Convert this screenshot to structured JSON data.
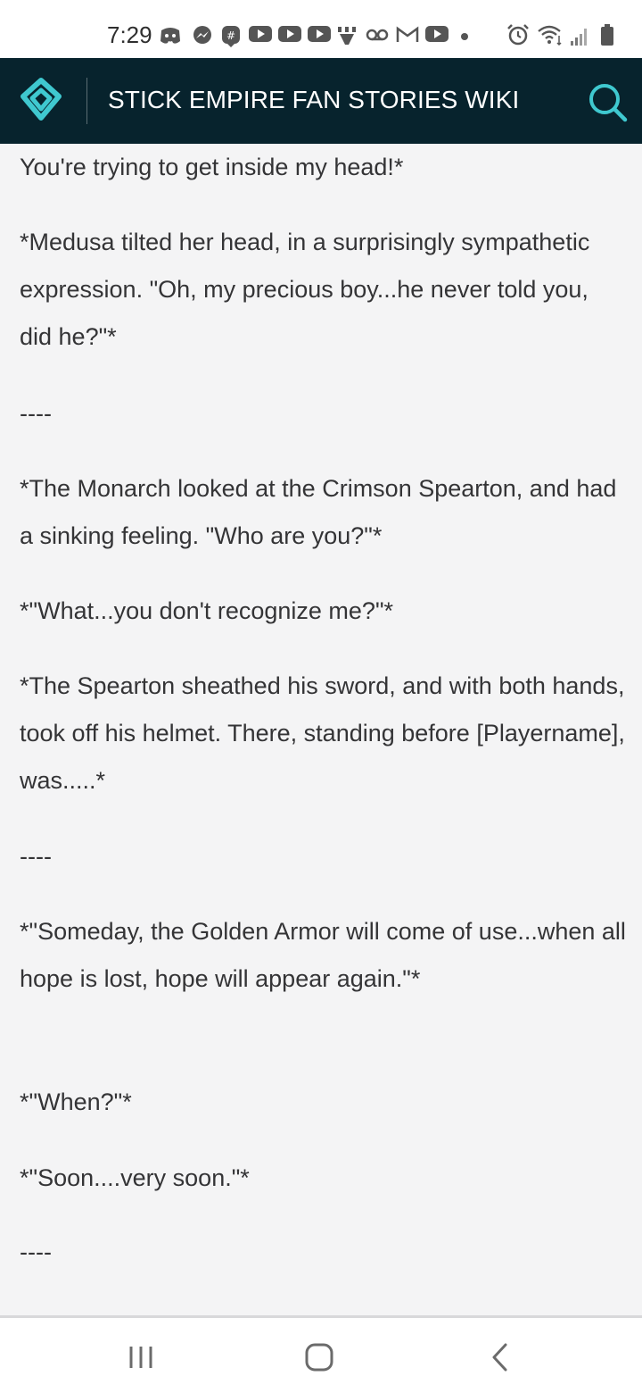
{
  "status_bar": {
    "time": "7:29",
    "left_icons": [
      "discord-icon",
      "messenger-icon",
      "groupme-icon",
      "youtube-icon",
      "youtube-icon",
      "youtube-icon",
      "app-icon",
      "voicemail-icon",
      "gmail-icon",
      "youtube-icon",
      "dot-icon"
    ],
    "right_icons": [
      "alarm-icon",
      "wifi-icon",
      "signal-icon",
      "battery-icon"
    ]
  },
  "header": {
    "title": "STICK EMPIRE FAN STORIES WIKI",
    "background": "#07232d",
    "accent": "#3fc8cf"
  },
  "article": {
    "paragraphs": [
      "You're trying to get inside my head!*",
      "*Medusa tilted her head, in a surprisingly sympathetic expression. \"Oh, my precious boy...he never told you, did he?\"*",
      "----",
      "*The Monarch looked at the Crimson Spearton, and had a sinking feeling. \"Who are you?\"*",
      "*\"What...you don't recognize me?\"*",
      "*The Spearton sheathed his sword, and with both hands, took off his helmet. There, standing before [Playername], was.....*",
      "----",
      "*\"Someday, the Golden Armor will come of use...when all hope is lost, hope will appear again.\"*",
      "*\"When?\"*",
      "*\"Soon....very soon.\"*",
      "----"
    ]
  },
  "nav_bar": {
    "buttons": [
      "recents-icon",
      "home-icon",
      "back-icon"
    ]
  }
}
